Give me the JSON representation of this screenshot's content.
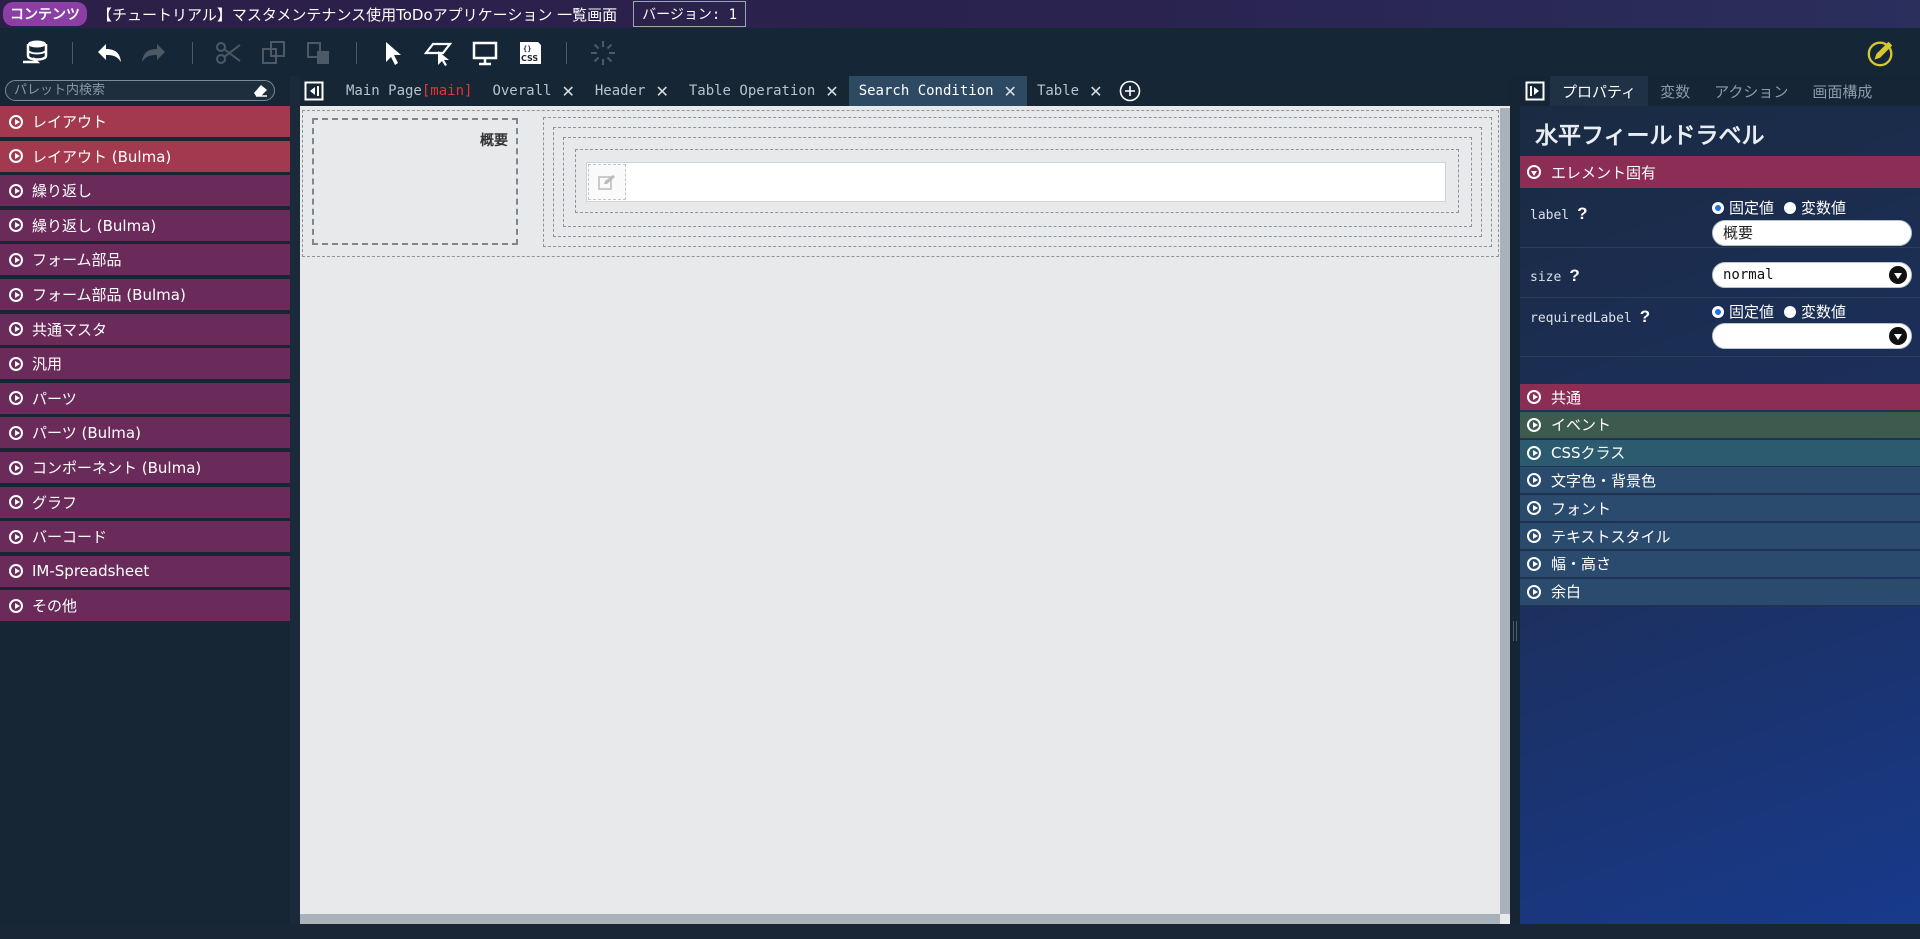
{
  "titlebar": {
    "badge": "コンテンツ",
    "title": "【チュートリアル】マスタメンテナンス使用ToDoアプリケーション 一覧画面",
    "version": "バージョン: 1"
  },
  "toolbar": {
    "css_label": "CSS"
  },
  "palette": {
    "search_placeholder": "パレット内検索",
    "items": [
      {
        "label": "レイアウト",
        "color": "#a2394f"
      },
      {
        "label": "レイアウト (Bulma)",
        "color": "#a2394f"
      },
      {
        "label": "繰り返し",
        "color": "#6a2b5b"
      },
      {
        "label": "繰り返し (Bulma)",
        "color": "#6a2b5b"
      },
      {
        "label": "フォーム部品",
        "color": "#6a2b5b"
      },
      {
        "label": "フォーム部品 (Bulma)",
        "color": "#6a2b5b"
      },
      {
        "label": "共通マスタ",
        "color": "#6a2b5b"
      },
      {
        "label": "汎用",
        "color": "#6a2b5b"
      },
      {
        "label": "パーツ",
        "color": "#6a2b5b"
      },
      {
        "label": "パーツ (Bulma)",
        "color": "#6a2b5b"
      },
      {
        "label": "コンポーネント (Bulma)",
        "color": "#6a2b5b"
      },
      {
        "label": "グラフ",
        "color": "#6a2b5b"
      },
      {
        "label": "バーコード",
        "color": "#6a2b5b"
      },
      {
        "label": "IM-Spreadsheet",
        "color": "#6a2b5b"
      },
      {
        "label": "その他",
        "color": "#6a2b5b"
      }
    ]
  },
  "tabs": [
    {
      "label": "Main Page",
      "tag": "[main]",
      "closable": false
    },
    {
      "label": "Overall",
      "closable": true
    },
    {
      "label": "Header",
      "closable": true
    },
    {
      "label": "Table Operation",
      "closable": true
    },
    {
      "label": "Search Condition",
      "closable": true,
      "active": true
    },
    {
      "label": "Table",
      "closable": true
    }
  ],
  "canvas": {
    "label_text": "概要"
  },
  "right_panel": {
    "tabs": [
      "プロパティ",
      "変数",
      "アクション",
      "画面構成"
    ],
    "heading": "水平フィールドラベル",
    "section_element": "エレメント固有",
    "props": {
      "label_name": "label",
      "size_name": "size",
      "required_name": "requiredLabel",
      "fixed": "固定値",
      "variable": "変数値",
      "label_value": "概要",
      "size_value": "normal",
      "required_value": ""
    },
    "sections": [
      {
        "label": "共通",
        "color": "#8b2d55"
      },
      {
        "label": "イベント",
        "color": "#3d5a4e"
      },
      {
        "label": "CSSクラス",
        "color": "#2c5a6e"
      },
      {
        "label": "文字色・背景色",
        "color": "#2a4a6e"
      },
      {
        "label": "フォント",
        "color": "#2a4a6e"
      },
      {
        "label": "テキストスタイル",
        "color": "#2a4a6e"
      },
      {
        "label": "幅・高さ",
        "color": "#2a4a6e"
      },
      {
        "label": "余白",
        "color": "#2a4a6e"
      }
    ]
  }
}
